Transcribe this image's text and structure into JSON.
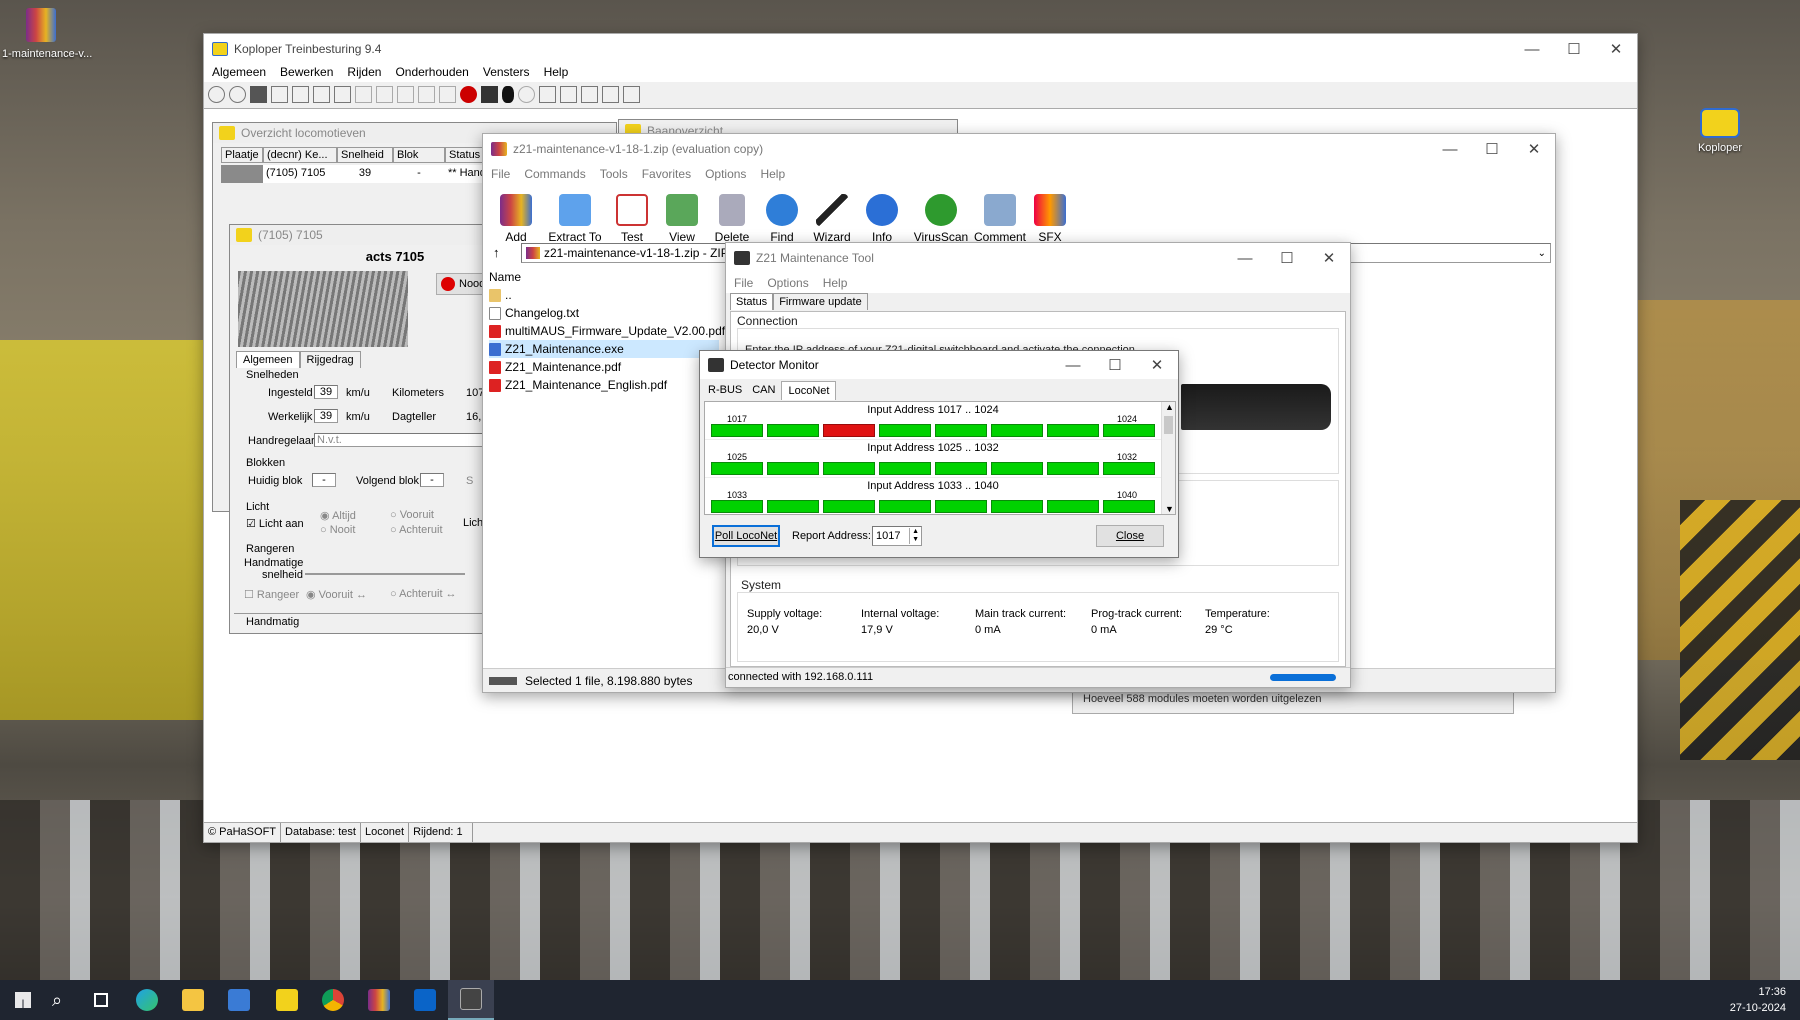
{
  "desktop": {
    "icon1_label": "1-maintenance-v...",
    "icon2_label": "Koploper"
  },
  "koploper": {
    "title": "Koploper Treinbesturing 9.4",
    "menu": [
      "Algemeen",
      "Bewerken",
      "Rijden",
      "Onderhouden",
      "Vensters",
      "Help"
    ],
    "status": [
      "© PaHaSOFT",
      "Database: test",
      "Loconet",
      "Rijdend: 1"
    ],
    "bottom_hint": "Hoeveel 588 modules moeten worden uitgelezen"
  },
  "overzicht": {
    "title": "Overzicht locomotieven",
    "headers": [
      "Plaatje",
      "(decnr) Ke...",
      "Snelheid",
      "Blok",
      "Status"
    ],
    "row": [
      "(7105) 7105",
      "39",
      "-",
      "** Hand"
    ]
  },
  "baan": {
    "title": "Baanoverzicht"
  },
  "loco": {
    "title": "(7105) 7105",
    "name": "acts 7105",
    "nood": "Nood",
    "tabs": [
      "Algemeen",
      "Rijgedrag"
    ],
    "snelheden": "Snelheden",
    "ingesteld_label": "Ingesteld",
    "ingesteld_val": "39",
    "unit": "km/u",
    "km_label": "Kilometers",
    "km_val": "107",
    "werkelijk_label": "Werkelijk",
    "werkelijk_val": "39",
    "dag_label": "Dagteller",
    "dag_val": "16,",
    "handregelaar_label": "Handregelaar",
    "handregelaar_val": "N.v.t.",
    "blokken": "Blokken",
    "huidig_label": "Huidig blok",
    "huidig_val": "-",
    "volgend_label": "Volgend blok",
    "volgend_val": "-",
    "s_label": "S",
    "licht": "Licht",
    "licht_aan": "Licht aan",
    "altijd": "Altijd",
    "nooit": "Nooit",
    "vooruit": "Vooruit",
    "achteruit": "Achteruit",
    "lich": "Lich",
    "rangeren": "Rangeren",
    "handmatige": "Handmatige",
    "snelheid": "snelheid",
    "rangeer": "Rangeer",
    "vooruit2": "Vooruit ↔",
    "achteruit2": "Achteruit ↔",
    "status_text": "Handmatig"
  },
  "winrar": {
    "title": "z21-maintenance-v1-18-1.zip (evaluation copy)",
    "menu": [
      "File",
      "Commands",
      "Tools",
      "Favorites",
      "Options",
      "Help"
    ],
    "toolbar": [
      "Add",
      "Extract To",
      "Test",
      "View",
      "Delete",
      "Find",
      "Wizard",
      "Info",
      "VirusScan",
      "Comment",
      "SFX"
    ],
    "path": "z21-maintenance-v1-18-1.zip - ZIP a",
    "col_name": "Name",
    "files": [
      "..",
      "Changelog.txt",
      "multiMAUS_Firmware_Update_V2.00.pdf",
      "Z21_Maintenance.exe",
      "Z21_Maintenance.pdf",
      "Z21_Maintenance_English.pdf"
    ],
    "status": "Selected 1 file, 8.198.880 bytes"
  },
  "z21": {
    "title": "Z21 Maintenance Tool",
    "menu": [
      "File",
      "Options",
      "Help"
    ],
    "tabs": [
      "Status",
      "Firmware update"
    ],
    "connection": "Connection",
    "hint": "Enter the IP address of your Z21-digital switchboard and activate the connection.",
    "system": "System",
    "sys_labels": [
      "Supply voltage:",
      "Internal voltage:",
      "Main track current:",
      "Prog-track current:",
      "Temperature:"
    ],
    "sys_values": [
      "20,0 V",
      "17,9 V",
      "0 mA",
      "0 mA",
      "29 °C"
    ],
    "status": "connected with 192.168.0.111"
  },
  "detector": {
    "title": "Detector Monitor",
    "tabs": [
      "R-BUS",
      "CAN",
      "LocoNet"
    ],
    "groups": [
      {
        "title": "Input Address 1017 .. 1024",
        "first": "1017",
        "last": "1024",
        "states": [
          1,
          1,
          0,
          1,
          1,
          1,
          1,
          1
        ]
      },
      {
        "title": "Input Address 1025 .. 1032",
        "first": "1025",
        "last": "1032",
        "states": [
          1,
          1,
          1,
          1,
          1,
          1,
          1,
          1
        ]
      },
      {
        "title": "Input Address 1033 .. 1040",
        "first": "1033",
        "last": "1040",
        "states": [
          1,
          1,
          1,
          1,
          1,
          1,
          1,
          1
        ]
      }
    ],
    "poll": "Poll LocoNet",
    "report_label": "Report Address:",
    "report_val": "1017",
    "close": "Close"
  },
  "taskbar": {
    "time": "17:36",
    "date": "27-10-2024"
  },
  "colors": {
    "occupied": "#00d200",
    "free": "#e01212",
    "taskbar": "#1f2530"
  }
}
